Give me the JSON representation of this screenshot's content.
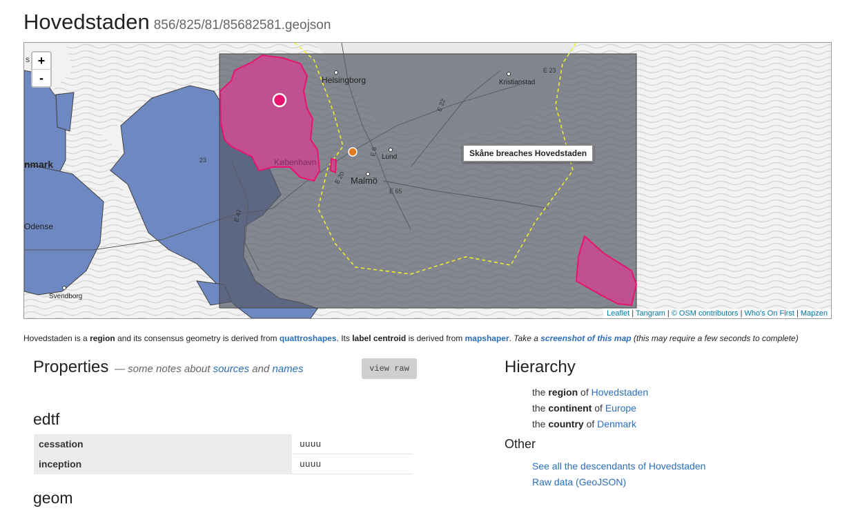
{
  "header": {
    "title": "Hovedstaden",
    "subtitle": "856/825/81/85682581.geojson"
  },
  "map": {
    "zoom_in": "+",
    "zoom_out": "-",
    "tooltip": "Skåne breaches Hovedstaden",
    "labels": {
      "denmark": "nmark",
      "helsingborg": "Helsingborg",
      "kristianstad": "Kristianstad",
      "kobenhavn": "København",
      "lund": "Lund",
      "malmo": "Malmö",
      "odense": "Odense",
      "svendborg": "Svendborg",
      "e65": "E 65",
      "e22": "E 22",
      "e23": "E 23",
      "e20": "E 20",
      "e47": "E 47",
      "e6": "E 6",
      "n23": "23",
      "s": "s"
    },
    "attribution": {
      "leaflet": "Leaflet",
      "tangram": "Tangram",
      "osm": "© OSM contributors",
      "wof": "Who's On First",
      "mapzen": "Mapzen",
      "sep": "|"
    },
    "colors": {
      "land": "#f2f2f2",
      "water_pattern": "#d6d6d6",
      "denmark_fill": "#6e88c2",
      "hovedstaden_fill": "#c0508f",
      "hovedstaden_stroke": "#e8146e",
      "bbox_overlay": "#555a66",
      "skane_boundary": "#f0f02a",
      "centroid_dot": "#e07a1c"
    }
  },
  "description": {
    "p1": "Hovedstaden is a ",
    "placetype": "region",
    "p2": " and its consensus geometry is derived from ",
    "geom_source": "quattroshapes",
    "p3": ". Its ",
    "label_centroid": "label centroid",
    "p4": " is derived from ",
    "centroid_source": "mapshaper",
    "p5": ". ",
    "take_a": "Take a ",
    "screenshot_link": "screenshot of this map",
    "note": " (this may require a few seconds to complete)"
  },
  "properties": {
    "title": "Properties",
    "notes_prefix": "— some notes about ",
    "sources_link": "sources",
    "and_word": " and ",
    "names_link": "names",
    "view_raw": "view raw",
    "edtf_heading": "edtf",
    "edtf_rows": [
      {
        "key": "cessation",
        "value": "uuuu"
      },
      {
        "key": "inception",
        "value": "uuuu"
      }
    ],
    "geom_heading": "geom"
  },
  "hierarchy": {
    "title": "Hierarchy",
    "items": [
      {
        "prefix": "the ",
        "type": "region",
        "of": " of ",
        "name": "Hovedstaden"
      },
      {
        "prefix": "the ",
        "type": "continent",
        "of": " of ",
        "name": "Europe"
      },
      {
        "prefix": "the ",
        "type": "country",
        "of": " of ",
        "name": "Denmark"
      }
    ]
  },
  "other": {
    "title": "Other",
    "links": [
      "See all the descendants of Hovedstaden",
      "Raw data (GeoJSON)"
    ]
  }
}
